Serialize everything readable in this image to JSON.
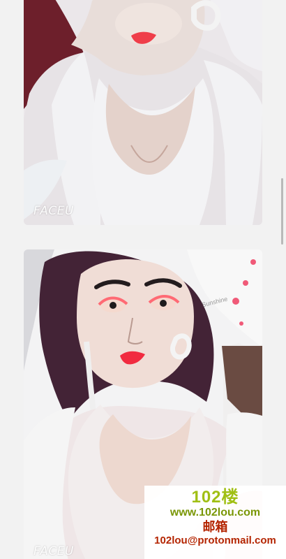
{
  "photos": [
    {
      "watermark": "FACEU"
    },
    {
      "watermark": "FACEU",
      "background_text": "Sunshine"
    }
  ],
  "overlay": {
    "logo": "102楼",
    "site": "www.102lou.com",
    "title": "邮箱",
    "email": "102lou@protonmail.com"
  },
  "colors": {
    "page_background": "#f2f2f2",
    "overlay_green": "#a0bf14",
    "overlay_red": "#b42400"
  }
}
